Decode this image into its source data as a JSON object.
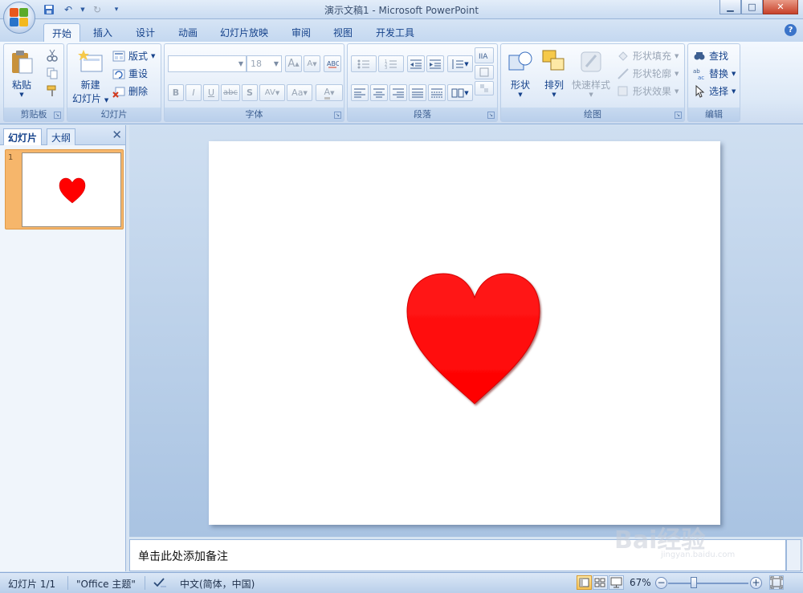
{
  "window": {
    "title": "演示文稿1 - Microsoft PowerPoint",
    "controls": {
      "minimize": "▁",
      "maximize": "□",
      "close": "✕"
    }
  },
  "ribbon": {
    "tabs": [
      {
        "label": "开始",
        "active": true
      },
      {
        "label": "插入"
      },
      {
        "label": "设计"
      },
      {
        "label": "动画"
      },
      {
        "label": "幻灯片放映"
      },
      {
        "label": "审阅"
      },
      {
        "label": "视图"
      },
      {
        "label": "开发工具"
      }
    ],
    "groups": {
      "clipboard": {
        "label": "剪贴板",
        "paste": "粘贴"
      },
      "slides": {
        "label": "幻灯片",
        "new_slide_line1": "新建",
        "new_slide_line2": "幻灯片",
        "layout": "版式",
        "reset": "重设",
        "delete": "删除"
      },
      "font": {
        "label": "字体",
        "font_name": "",
        "font_size": "18",
        "bold": "B",
        "italic": "I",
        "underline": "U",
        "strike": "abc",
        "shadow": "S",
        "spacing": "AV",
        "case": "Aa",
        "grow": "A",
        "shrink": "A",
        "color": "A"
      },
      "paragraph": {
        "label": "段落"
      },
      "drawing": {
        "label": "绘图",
        "shapes": "形状",
        "arrange": "排列",
        "quick_styles": "快速样式",
        "shape_fill": "形状填充",
        "shape_outline": "形状轮廓",
        "shape_effects": "形状效果"
      },
      "editing": {
        "label": "编辑",
        "find": "查找",
        "replace": "替换",
        "select": "选择"
      }
    }
  },
  "left_panel": {
    "tabs": [
      {
        "label": "幻灯片",
        "active": true
      },
      {
        "label": "大纲"
      }
    ],
    "close": "✕",
    "thumbnails": [
      {
        "number": "1"
      }
    ]
  },
  "notes": {
    "placeholder": "单击此处添加备注"
  },
  "status_bar": {
    "slide_info": "幻灯片 1/1",
    "theme": "\"Office 主题\"",
    "language": "中文(简体，中国)",
    "zoom": "67%",
    "zoom_level": 0.67
  },
  "watermark": {
    "text": "Bai经验",
    "sub": "jingyan.baidu.com"
  },
  "colors": {
    "heart": "#ff0000",
    "accent": "#15428b",
    "active_thumb": "#f6b66b"
  }
}
